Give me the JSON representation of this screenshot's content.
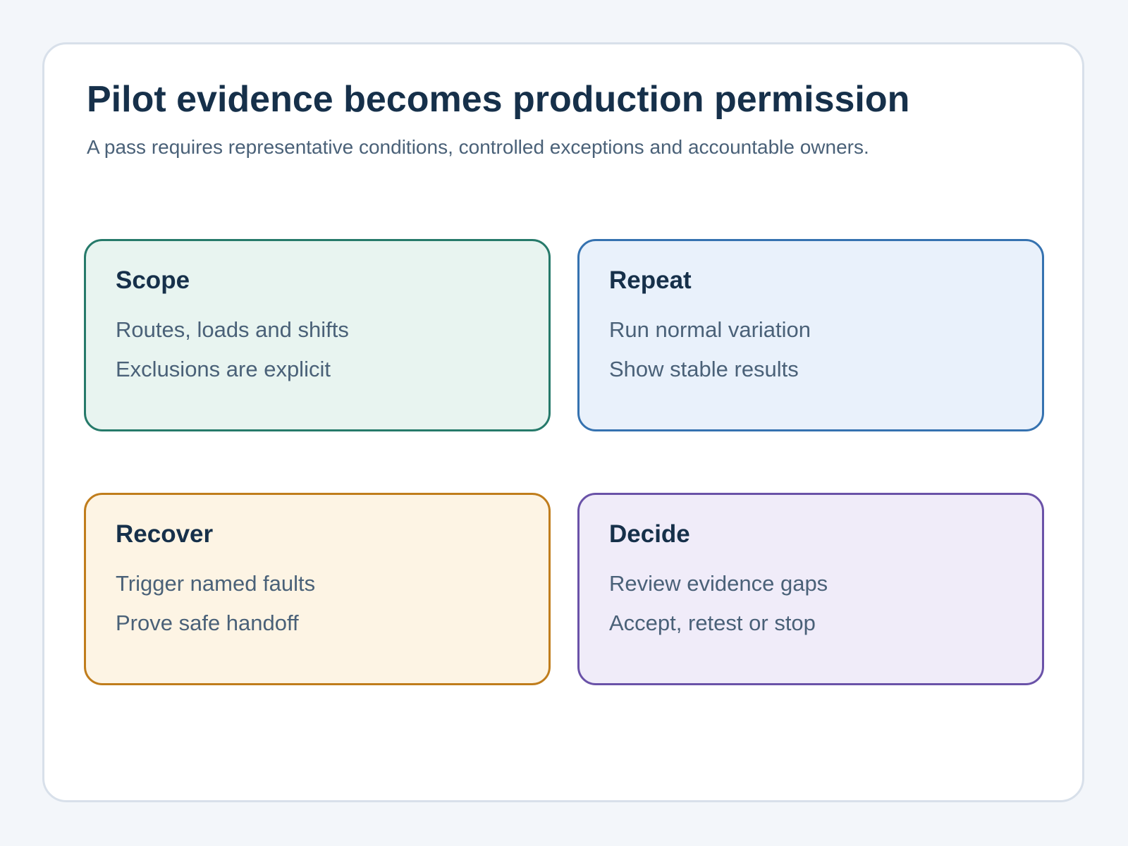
{
  "title": "Pilot evidence becomes production permission",
  "subtitle": "A pass requires representative conditions, controlled exceptions and accountable owners.",
  "cards": [
    {
      "title": "Scope",
      "lines": [
        "Routes, loads and shifts",
        "Exclusions are explicit"
      ],
      "border_color": "#267a6a",
      "fill_color": "#e8f4f0"
    },
    {
      "title": "Repeat",
      "lines": [
        "Run normal variation",
        "Show stable results"
      ],
      "border_color": "#3572b0",
      "fill_color": "#e9f1fb"
    },
    {
      "title": "Recover",
      "lines": [
        "Trigger named faults",
        "Prove safe handoff"
      ],
      "border_color": "#c07d1c",
      "fill_color": "#fdf4e4"
    },
    {
      "title": "Decide",
      "lines": [
        "Review evidence gaps",
        "Accept, retest or stop"
      ],
      "border_color": "#6a52a8",
      "fill_color": "#f0ecf9"
    }
  ]
}
